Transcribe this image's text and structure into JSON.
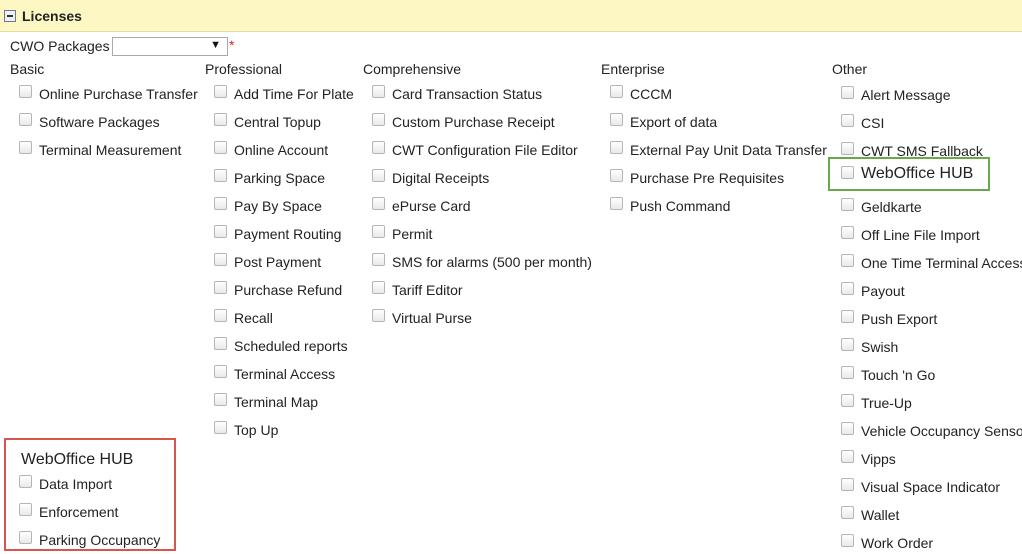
{
  "section": {
    "title": "Licenses"
  },
  "packages": {
    "label": "CWO Packages",
    "selected": "",
    "required_mark": "*"
  },
  "columns": [
    {
      "title": "Basic",
      "items": [
        "Online Purchase Transfer",
        "Software Packages",
        "Terminal Measurement"
      ]
    },
    {
      "title": "Professional",
      "items": [
        "Add Time For Plate",
        "Central Topup",
        "Online Account",
        "Parking Space",
        "Pay By Space",
        "Payment Routing",
        "Post Payment",
        "Purchase Refund",
        "Recall",
        "Scheduled reports",
        "Terminal Access",
        "Terminal Map",
        "Top Up"
      ]
    },
    {
      "title": "Comprehensive",
      "items": [
        "Card Transaction Status",
        "Custom Purchase Receipt",
        "CWT Configuration File Editor",
        "Digital Receipts",
        "ePurse Card",
        "Permit",
        "SMS for alarms (500 per month)",
        "Tariff Editor",
        "Virtual Purse"
      ]
    },
    {
      "title": "Enterprise",
      "items": [
        "CCCM",
        "Export of data",
        "External Pay Unit Data Transfer",
        "Purchase Pre Requisites",
        "Push Command"
      ]
    },
    {
      "title": "Other",
      "items": [
        "Alert Message",
        "CSI",
        "CWT SMS Fallback",
        "WebOffice HUB",
        "Geldkarte",
        "Off Line File Import",
        "One Time Terminal Access",
        "Payout",
        "Push Export",
        "Swish",
        "Touch 'n Go",
        "True-Up",
        "Vehicle Occupancy Sensor",
        "Vipps",
        "Visual Space Indicator",
        "Wallet",
        "Work Order"
      ]
    }
  ],
  "webOfficeHub": {
    "title": "WebOffice HUB",
    "items": [
      "Data Import",
      "Enforcement",
      "Parking Occupancy"
    ]
  }
}
